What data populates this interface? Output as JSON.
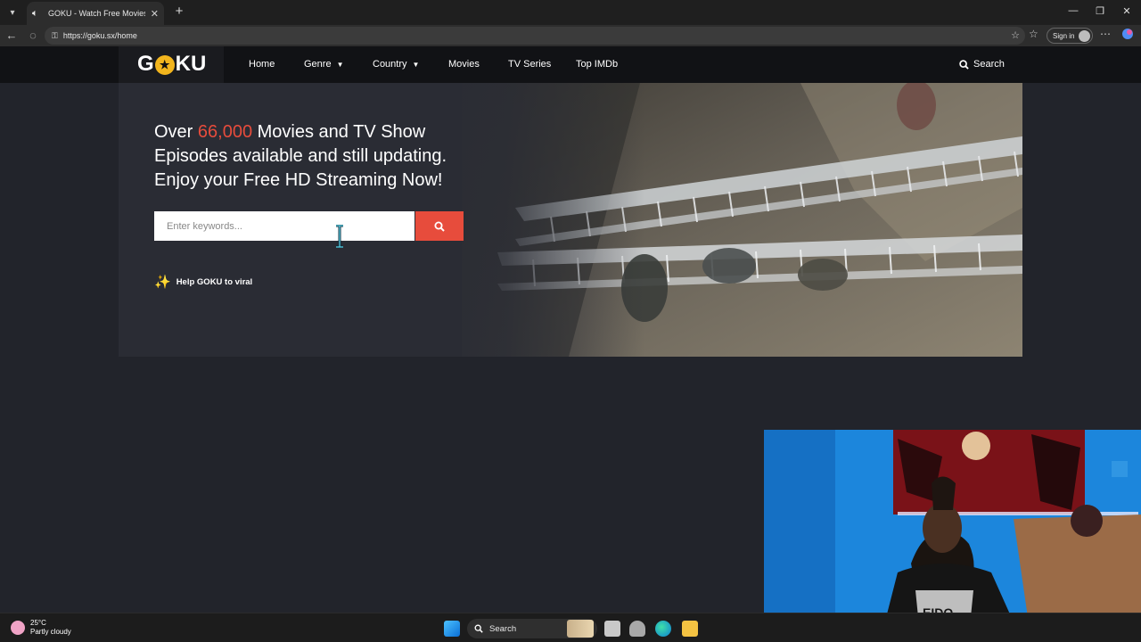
{
  "browser": {
    "tab_title": "GOKU - Watch Free Movies O",
    "url": "https://goku.sx/home",
    "sign_in_label": "Sign in"
  },
  "site": {
    "logo_text_left": "G",
    "logo_text_right": "KU",
    "nav": {
      "home": "Home",
      "genre": "Genre",
      "country": "Country",
      "movies": "Movies",
      "tv_series": "TV Series",
      "top_imdb": "Top IMDb"
    },
    "search_link": "Search"
  },
  "hero": {
    "headline_prefix": "Over ",
    "headline_count": "66,000",
    "headline_rest": " Movies and TV Show Episodes available and still updating. Enjoy your Free HD Streaming Now!",
    "search_placeholder": "Enter keywords...",
    "viral_label": "Help GOKU to viral"
  },
  "taskbar": {
    "temperature": "25°C",
    "weather": "Partly cloudy",
    "search_label": "Search"
  },
  "colors": {
    "accent": "#e74c3c",
    "logo_yellow": "#f2b51d"
  }
}
